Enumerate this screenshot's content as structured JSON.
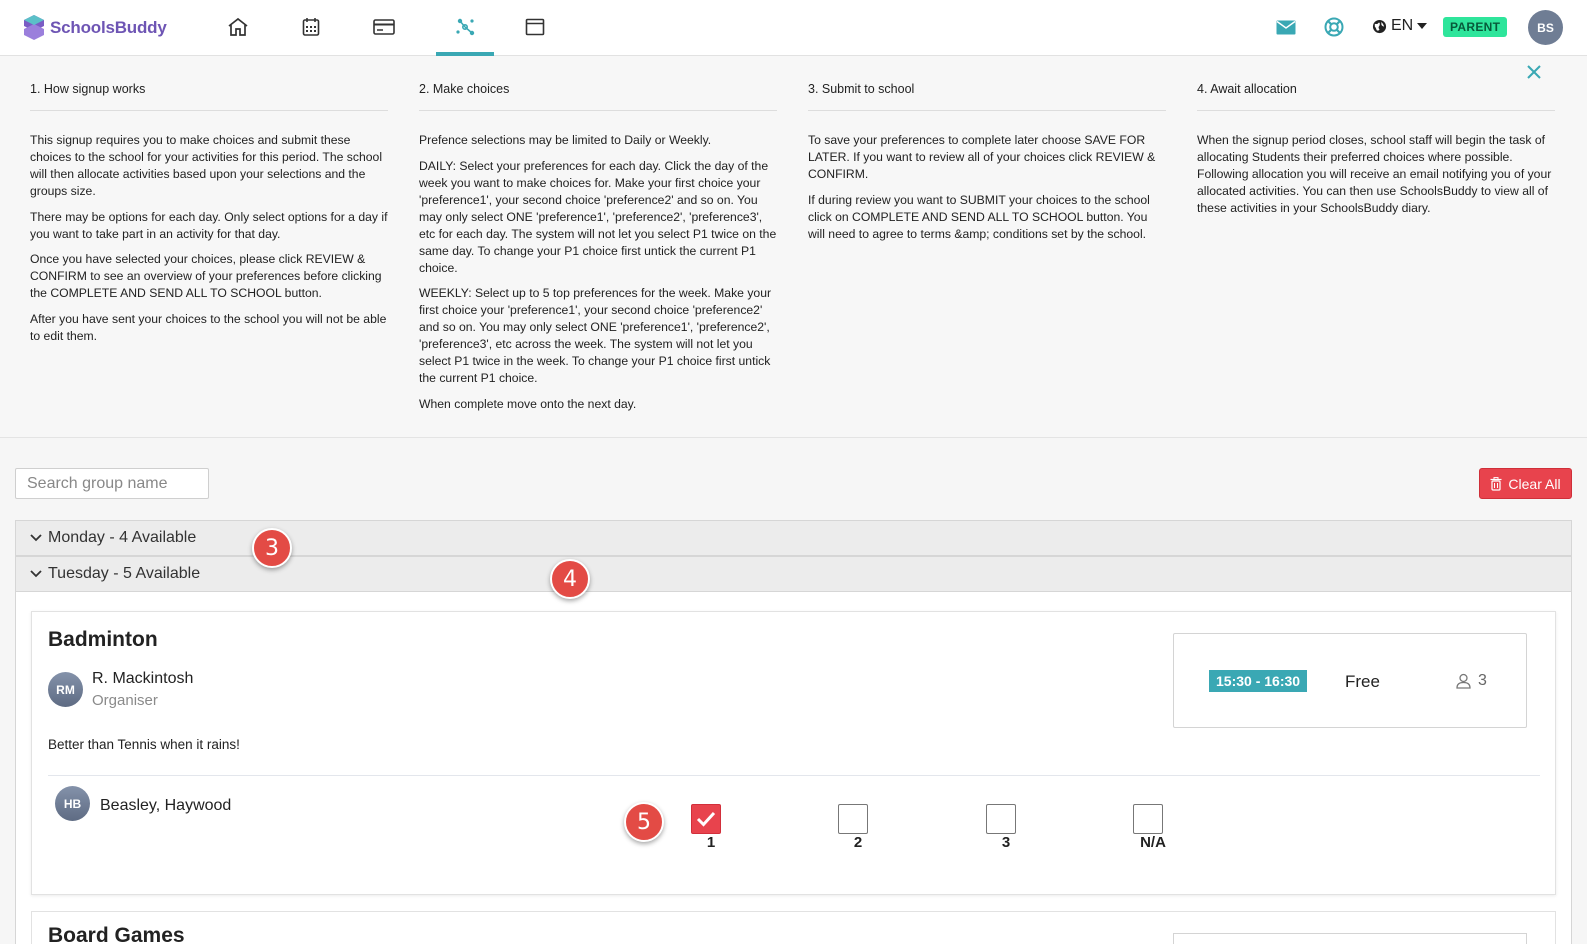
{
  "app": {
    "name": "SchoolsBuddy"
  },
  "nav": {
    "items": [
      {
        "icon": "home-icon"
      },
      {
        "icon": "calendar-icon"
      },
      {
        "icon": "payment-card-icon"
      },
      {
        "icon": "activities-icon",
        "active": true
      },
      {
        "icon": "window-icon"
      }
    ]
  },
  "header_right": {
    "language": "EN",
    "role_badge": "PARENT",
    "user_initials": "BS"
  },
  "info_panel": {
    "columns": [
      {
        "title": "1. How signup works",
        "paragraphs": [
          "This signup requires you to make choices and submit these choices to the school for your activities for this period. The school will then allocate activities based upon your selections and the groups size.",
          "There may be options for each day. Only select options for a day if you want to take part in an activity for that day.",
          "Once you have selected your choices, please click REVIEW & CONFIRM to see an overview of your preferences before clicking the COMPLETE AND SEND ALL TO SCHOOL button.",
          "After you have sent your choices to the school you will not be able to edit them."
        ]
      },
      {
        "title": "2. Make choices",
        "paragraphs": [
          "Prefence selections may be limited to Daily or Weekly.",
          "DAILY: Select your preferences for each day. Click the day of the week you want to make choices for. Make your first choice your 'preference1', your second choice 'preference2' and so on. You may only select ONE 'preference1', 'preference2', 'preference3', etc for each day. The system will not let you select P1 twice on the same day. To change your P1 choice first untick the current P1 choice.",
          "WEEKLY: Select up to 5 top preferences for the week. Make your first choice your 'preference1', your second choice 'preference2' and so on. You may only select ONE 'preference1', 'preference2', 'preference3', etc across the week. The system will not let you select P1 twice in the week. To change your P1 choice first untick the current P1 choice.",
          "When complete move onto the next day."
        ]
      },
      {
        "title": "3. Submit to school",
        "paragraphs": [
          "To save your preferences to complete later choose SAVE FOR LATER. If you want to review all of your choices click REVIEW & CONFIRM.",
          "If during review you want to SUBMIT your choices to the school click on COMPLETE AND SEND ALL TO SCHOOL button. You will need to agree to terms &amp; conditions set by the school."
        ]
      },
      {
        "title": "4. Await allocation",
        "paragraphs": [
          "When the signup period closes, school staff will begin the task of allocating Students their preferred choices where possible. Following allocation you will receive an email notifying you of your allocated activities. You can then use SchoolsBuddy to view all of these activities in your SchoolsBuddy diary."
        ]
      }
    ]
  },
  "search": {
    "placeholder": "Search group name",
    "value": ""
  },
  "clear_all_label": "Clear All",
  "days": [
    {
      "label": "Monday - 4 Available"
    },
    {
      "label": "Tuesday - 5 Available"
    }
  ],
  "activity": {
    "title": "Badminton",
    "organiser": {
      "initials": "RM",
      "name": "R. Mackintosh",
      "role": "Organiser"
    },
    "description": "Better than Tennis when it rains!",
    "session": {
      "time": "15:30 - 16:30",
      "price": "Free",
      "capacity": "3"
    },
    "student": {
      "initials": "HB",
      "name": "Beasley, Haywood"
    },
    "preferences": [
      {
        "label": "1",
        "checked": true
      },
      {
        "label": "2",
        "checked": false
      },
      {
        "label": "3",
        "checked": false
      },
      {
        "label": "N/A",
        "checked": false
      }
    ]
  },
  "next_activity": {
    "title": "Board Games"
  },
  "markers": [
    "3",
    "4",
    "5"
  ],
  "colors": {
    "accent": "#3aa8b4",
    "danger": "#e8434d",
    "badge": "#2ee59b",
    "brand": "#6e55b4"
  }
}
